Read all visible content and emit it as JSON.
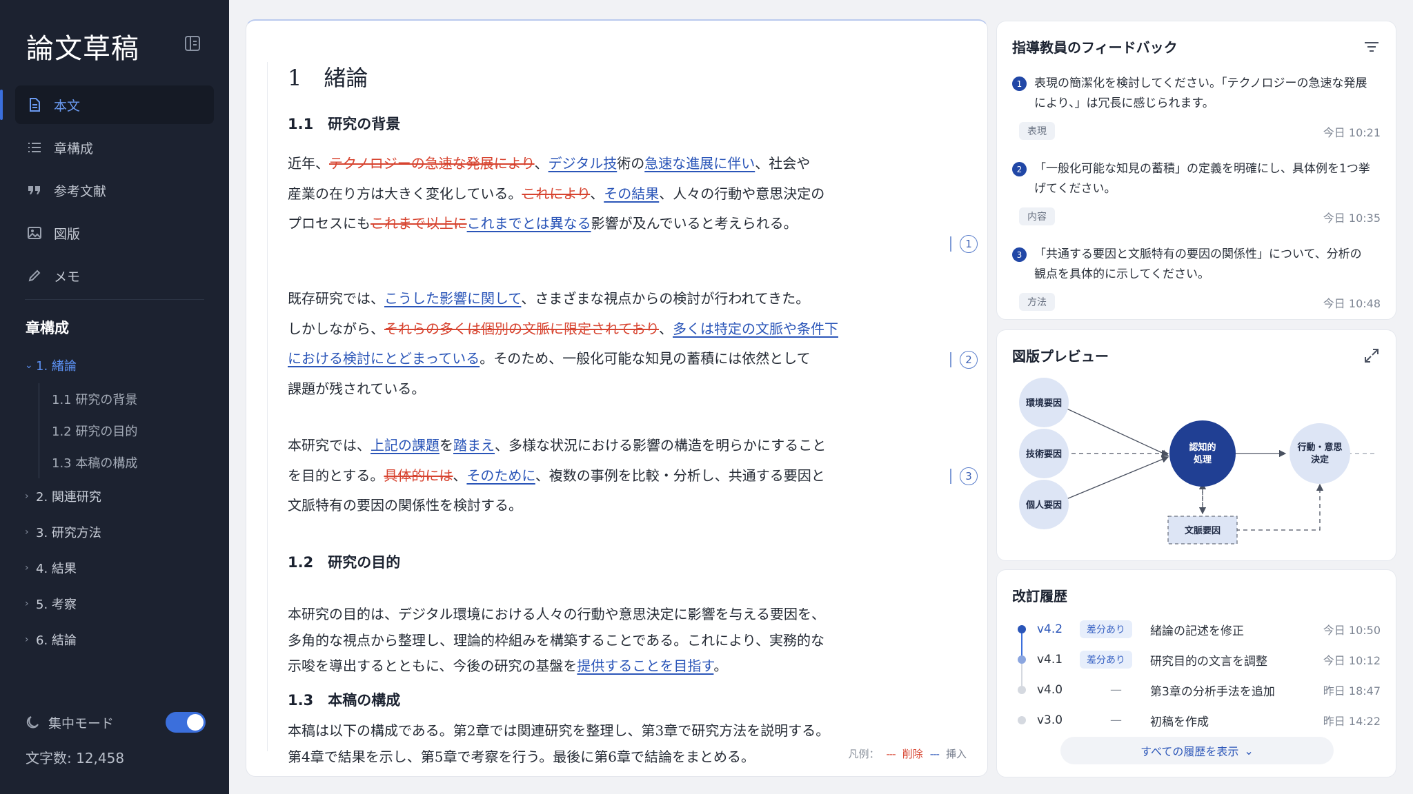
{
  "sidebar": {
    "app_title": "論文草稿",
    "nav": [
      {
        "label": "本文",
        "icon": "document-icon"
      },
      {
        "label": "章構成",
        "icon": "list-icon"
      },
      {
        "label": "参考文献",
        "icon": "quote-icon"
      },
      {
        "label": "図版",
        "icon": "image-icon"
      },
      {
        "label": "メモ",
        "icon": "pencil-icon"
      }
    ],
    "toc_heading": "章構成",
    "toc": {
      "open": "1. 緒論",
      "subs": [
        "1.1 研究の背景",
        "1.2 研究の目的",
        "1.3 本稿の構成"
      ],
      "closed": [
        "2. 関連研究",
        "3. 研究方法",
        "4. 結果",
        "5. 考察",
        "6. 結論"
      ]
    },
    "focus_mode_label": "集中モード",
    "focus_mode_on": true,
    "char_count": "文字数: 12,458"
  },
  "doc": {
    "h1": "1　緒論",
    "s11": "1.1　研究の背景",
    "p1": {
      "l1": {
        "a": "近年、",
        "del": "テクノロジーの急速な発展により",
        "b": "、",
        "ins1": "デジタル技",
        "c": "術の",
        "ins2": "急速な進展に伴い",
        "d": "、社会や"
      },
      "l2": {
        "a": "産業の在り方は大きく変化している。",
        "del": "これにより",
        "b": "、",
        "ins": "その結果",
        "c": "、人々の行動や意思決定の"
      },
      "l3": {
        "a": "プロセスにも",
        "del": "これまで以上に",
        "ins": "これまでとは異なる",
        "b": "影響が及んでいると考えられる。"
      }
    },
    "p2": {
      "l1": {
        "a": "既存研究では、",
        "ins": "こうした影響に関して",
        "b": "、さまざまな視点からの検討が行われてきた。"
      },
      "l2": {
        "a": "しかしながら、",
        "del": "それらの多くは個別の文脈に限定されており",
        "b": "、",
        "ins": "多くは特定の文脈や条件下"
      },
      "l3": {
        "ins": "における検討にとどまっている",
        "b": "。そのため、一般化可能な知見の蓄積には依然として"
      },
      "l4": "課題が残されている。"
    },
    "p3": {
      "l1": {
        "a": "本研究では、",
        "ins1": "上記の課題",
        "b": "を",
        "ins2": "踏まえ",
        "c": "、多様な状況における影響の構造を明らかにすること"
      },
      "l2": {
        "a": "を目的とする。",
        "del": "具体的には",
        "b": "、",
        "ins": "そのために",
        "c": "、複数の事例を比較・分析し、共通する要因と"
      },
      "l3": "文脈特有の要因の関係性を検討する。"
    },
    "markers": [
      "1",
      "2",
      "3"
    ],
    "s12": "1.2　研究の目的",
    "p4": {
      "l1": "本研究の目的は、デジタル環境における人々の行動や意思決定に影響を与える要因を、",
      "l2": "多角的な視点から整理し、理論的枠組みを構築することである。これにより、実務的な",
      "l3": {
        "a": "示唆を導出するとともに、今後の研究の基盤を",
        "ins": "提供することを目指す",
        "b": "。"
      }
    },
    "s13": "1.3　本稿の構成",
    "p5": {
      "l1": "本稿は以下の構成である。第2章では関連研究を整理し、第3章で研究方法を説明する。",
      "l2": "第4章で結果を示し、第5章で考察を行う。最後に第6章で結論をまとめる。"
    },
    "legend": {
      "label": "凡例：",
      "del_mark": "---",
      "del": "削除",
      "ins_mark": "---",
      "ins": "挿入"
    }
  },
  "feedback": {
    "title": "指導教員のフィードバック",
    "items": [
      {
        "num": "1",
        "text": "表現の簡潔化を検討してください。「テクノロジーの急速な発展により、」は冗長に感じられます。",
        "tag": "表現",
        "time": "今日 10:21"
      },
      {
        "num": "2",
        "text": "「一般化可能な知見の蓄積」の定義を明確にし、具体例を1つ挙げてください。",
        "tag": "内容",
        "time": "今日 10:35"
      },
      {
        "num": "3",
        "text": "「共通する要因と文脈特有の要因の関係性」について、分析の観点を具体的に示してください。",
        "tag": "方法",
        "time": "今日 10:48"
      }
    ]
  },
  "figure": {
    "title": "図版プレビュー",
    "nodes": {
      "env": "環境要因",
      "tech": "技術要因",
      "personal": "個人要因",
      "cog1": "認知的",
      "cog2": "処理",
      "act1": "行動・意思",
      "act2": "決定",
      "context": "文脈要因"
    }
  },
  "revisions": {
    "title": "改訂履歴",
    "items": [
      {
        "ver": "v4.2",
        "badge": "差分あり",
        "desc": "緒論の記述を修正",
        "time": "今日 10:50"
      },
      {
        "ver": "v4.1",
        "badge": "差分あり",
        "desc": "研究目的の文言を調整",
        "time": "今日 10:12"
      },
      {
        "ver": "v4.0",
        "badge": "—",
        "desc": "第3章の分析手法を追加",
        "time": "昨日 18:47"
      },
      {
        "ver": "v3.0",
        "badge": "—",
        "desc": "初稿を作成",
        "time": "昨日 14:22"
      }
    ],
    "show_all": "すべての履歴を表示"
  },
  "colors": {
    "accent": "#3b6fdc",
    "deleted": "#d7432f",
    "inserted": "#2a55b8",
    "sidebar": "#1c2230"
  }
}
